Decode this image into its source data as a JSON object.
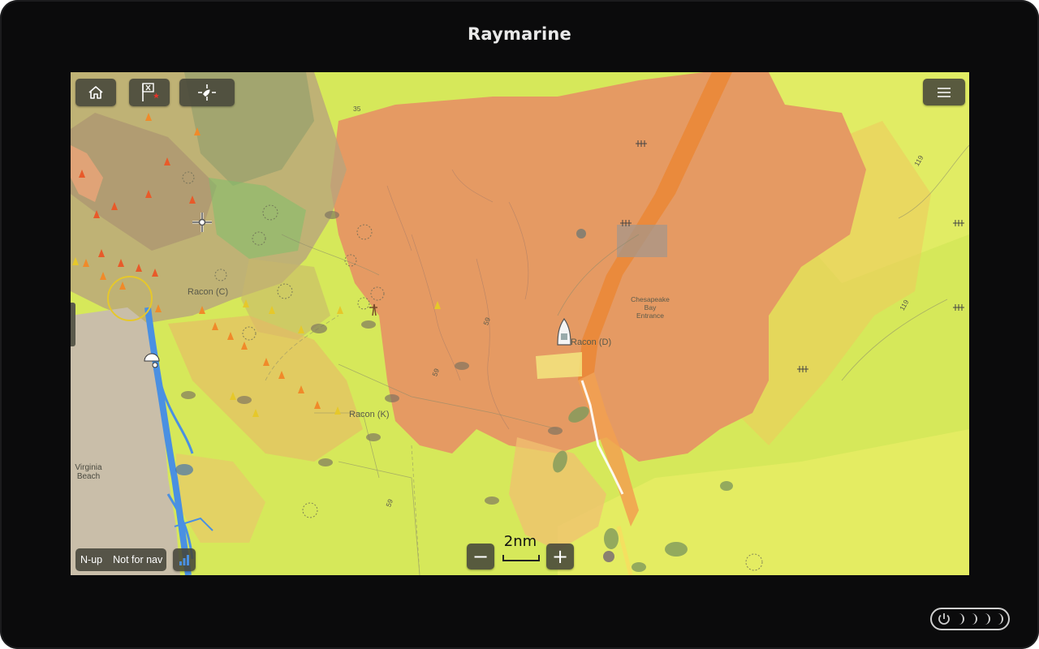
{
  "device": {
    "brand": "Raymarine"
  },
  "toolbar": {
    "home_icon": "home-icon",
    "waypoint_icon": "waypoint-flag-icon",
    "find_ship_icon": "find-ship-icon",
    "menu_icon": "hamburger-menu-icon"
  },
  "map": {
    "labels": {
      "racon_c": "Racon (C)",
      "racon_d": "Racon (D)",
      "racon_k": "Racon (K)",
      "chesapeake": [
        "Chesapeake",
        "Bay",
        "Entrance"
      ],
      "virginia_beach": [
        "Virginia",
        "Beach"
      ],
      "depth_35": "35",
      "depth_59a": "59",
      "depth_59b": "59",
      "depth_59c": "59",
      "depth_119a": "119",
      "depth_119b": "119"
    }
  },
  "status": {
    "orientation": "N-up",
    "disclaimer": "Not for nav"
  },
  "zoom": {
    "scale": "2nm",
    "minus": "−",
    "plus": "+"
  },
  "colors": {
    "sea_yellow": "#d6e85a",
    "heat_orange": "#e59a63",
    "heat_dark_orange": "#ea8a3c",
    "land": "#c9bea9",
    "water_blue": "#4a90e2"
  }
}
